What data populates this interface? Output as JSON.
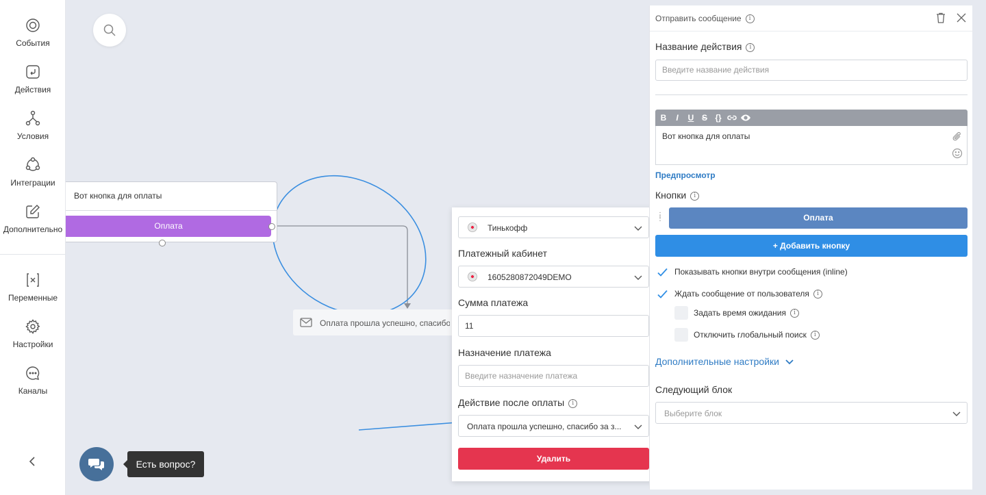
{
  "sidebar": {
    "items": [
      {
        "label": "События",
        "icon": "events-icon"
      },
      {
        "label": "Действия",
        "icon": "actions-icon"
      },
      {
        "label": "Условия",
        "icon": "conditions-icon"
      },
      {
        "label": "Интеграции",
        "icon": "integrations-icon"
      },
      {
        "label": "Дополнительно",
        "icon": "additional-icon"
      },
      {
        "label": "Переменные",
        "icon": "variables-icon"
      },
      {
        "label": "Настройки",
        "icon": "gear-icon"
      },
      {
        "label": "Каналы",
        "icon": "chat-icon"
      }
    ]
  },
  "canvas": {
    "node": {
      "text": "Вот кнопка для оплаты",
      "button_label": "Оплата"
    },
    "message_node": {
      "text": "Оплата прошла успешно, спасибо"
    }
  },
  "payment_popup": {
    "provider": "Тинькофф",
    "cabinet_label": "Платежный кабинет",
    "cabinet_value": "1605280872049DEMO",
    "amount_label": "Сумма платежа",
    "amount_value": "11",
    "purpose_label": "Назначение платежа",
    "purpose_placeholder": "Введите назначение платежа",
    "after_label": "Действие после оплаты",
    "after_value": "Оплата прошла успешно, спасибо за з...",
    "delete_label": "Удалить"
  },
  "help": {
    "tooltip": "Есть вопрос?"
  },
  "panel": {
    "title": "Отправить сообщение",
    "action_name_label": "Название действия",
    "action_name_placeholder": "Введите название действия",
    "toolbar": [
      "B",
      "I",
      "U",
      "S",
      "{}"
    ],
    "message_text": "Вот кнопка для оплаты",
    "preview_link": "Предпросмотр",
    "buttons_label": "Кнопки",
    "button_oplata": "Оплата",
    "add_button": "+ Добавить кнопку",
    "checks": [
      {
        "label": "Показывать кнопки внутри сообщения (inline)",
        "checked": true
      },
      {
        "label": "Ждать сообщение от пользователя",
        "checked": true
      },
      {
        "label": "Задать время ожидания",
        "checked": false
      },
      {
        "label": "Отключить глобальный поиск",
        "checked": false
      }
    ],
    "advanced_link": "Дополнительные настройки",
    "next_block_label": "Следующий блок",
    "next_block_placeholder": "Выберите блок"
  },
  "colors": {
    "node_button": "#b06ae2",
    "delete": "#e5354f",
    "add_button": "#2f8ee5",
    "oplata_button": "#5b86c1",
    "link": "#2e7bc4",
    "annotation": "#3a8ee0"
  }
}
